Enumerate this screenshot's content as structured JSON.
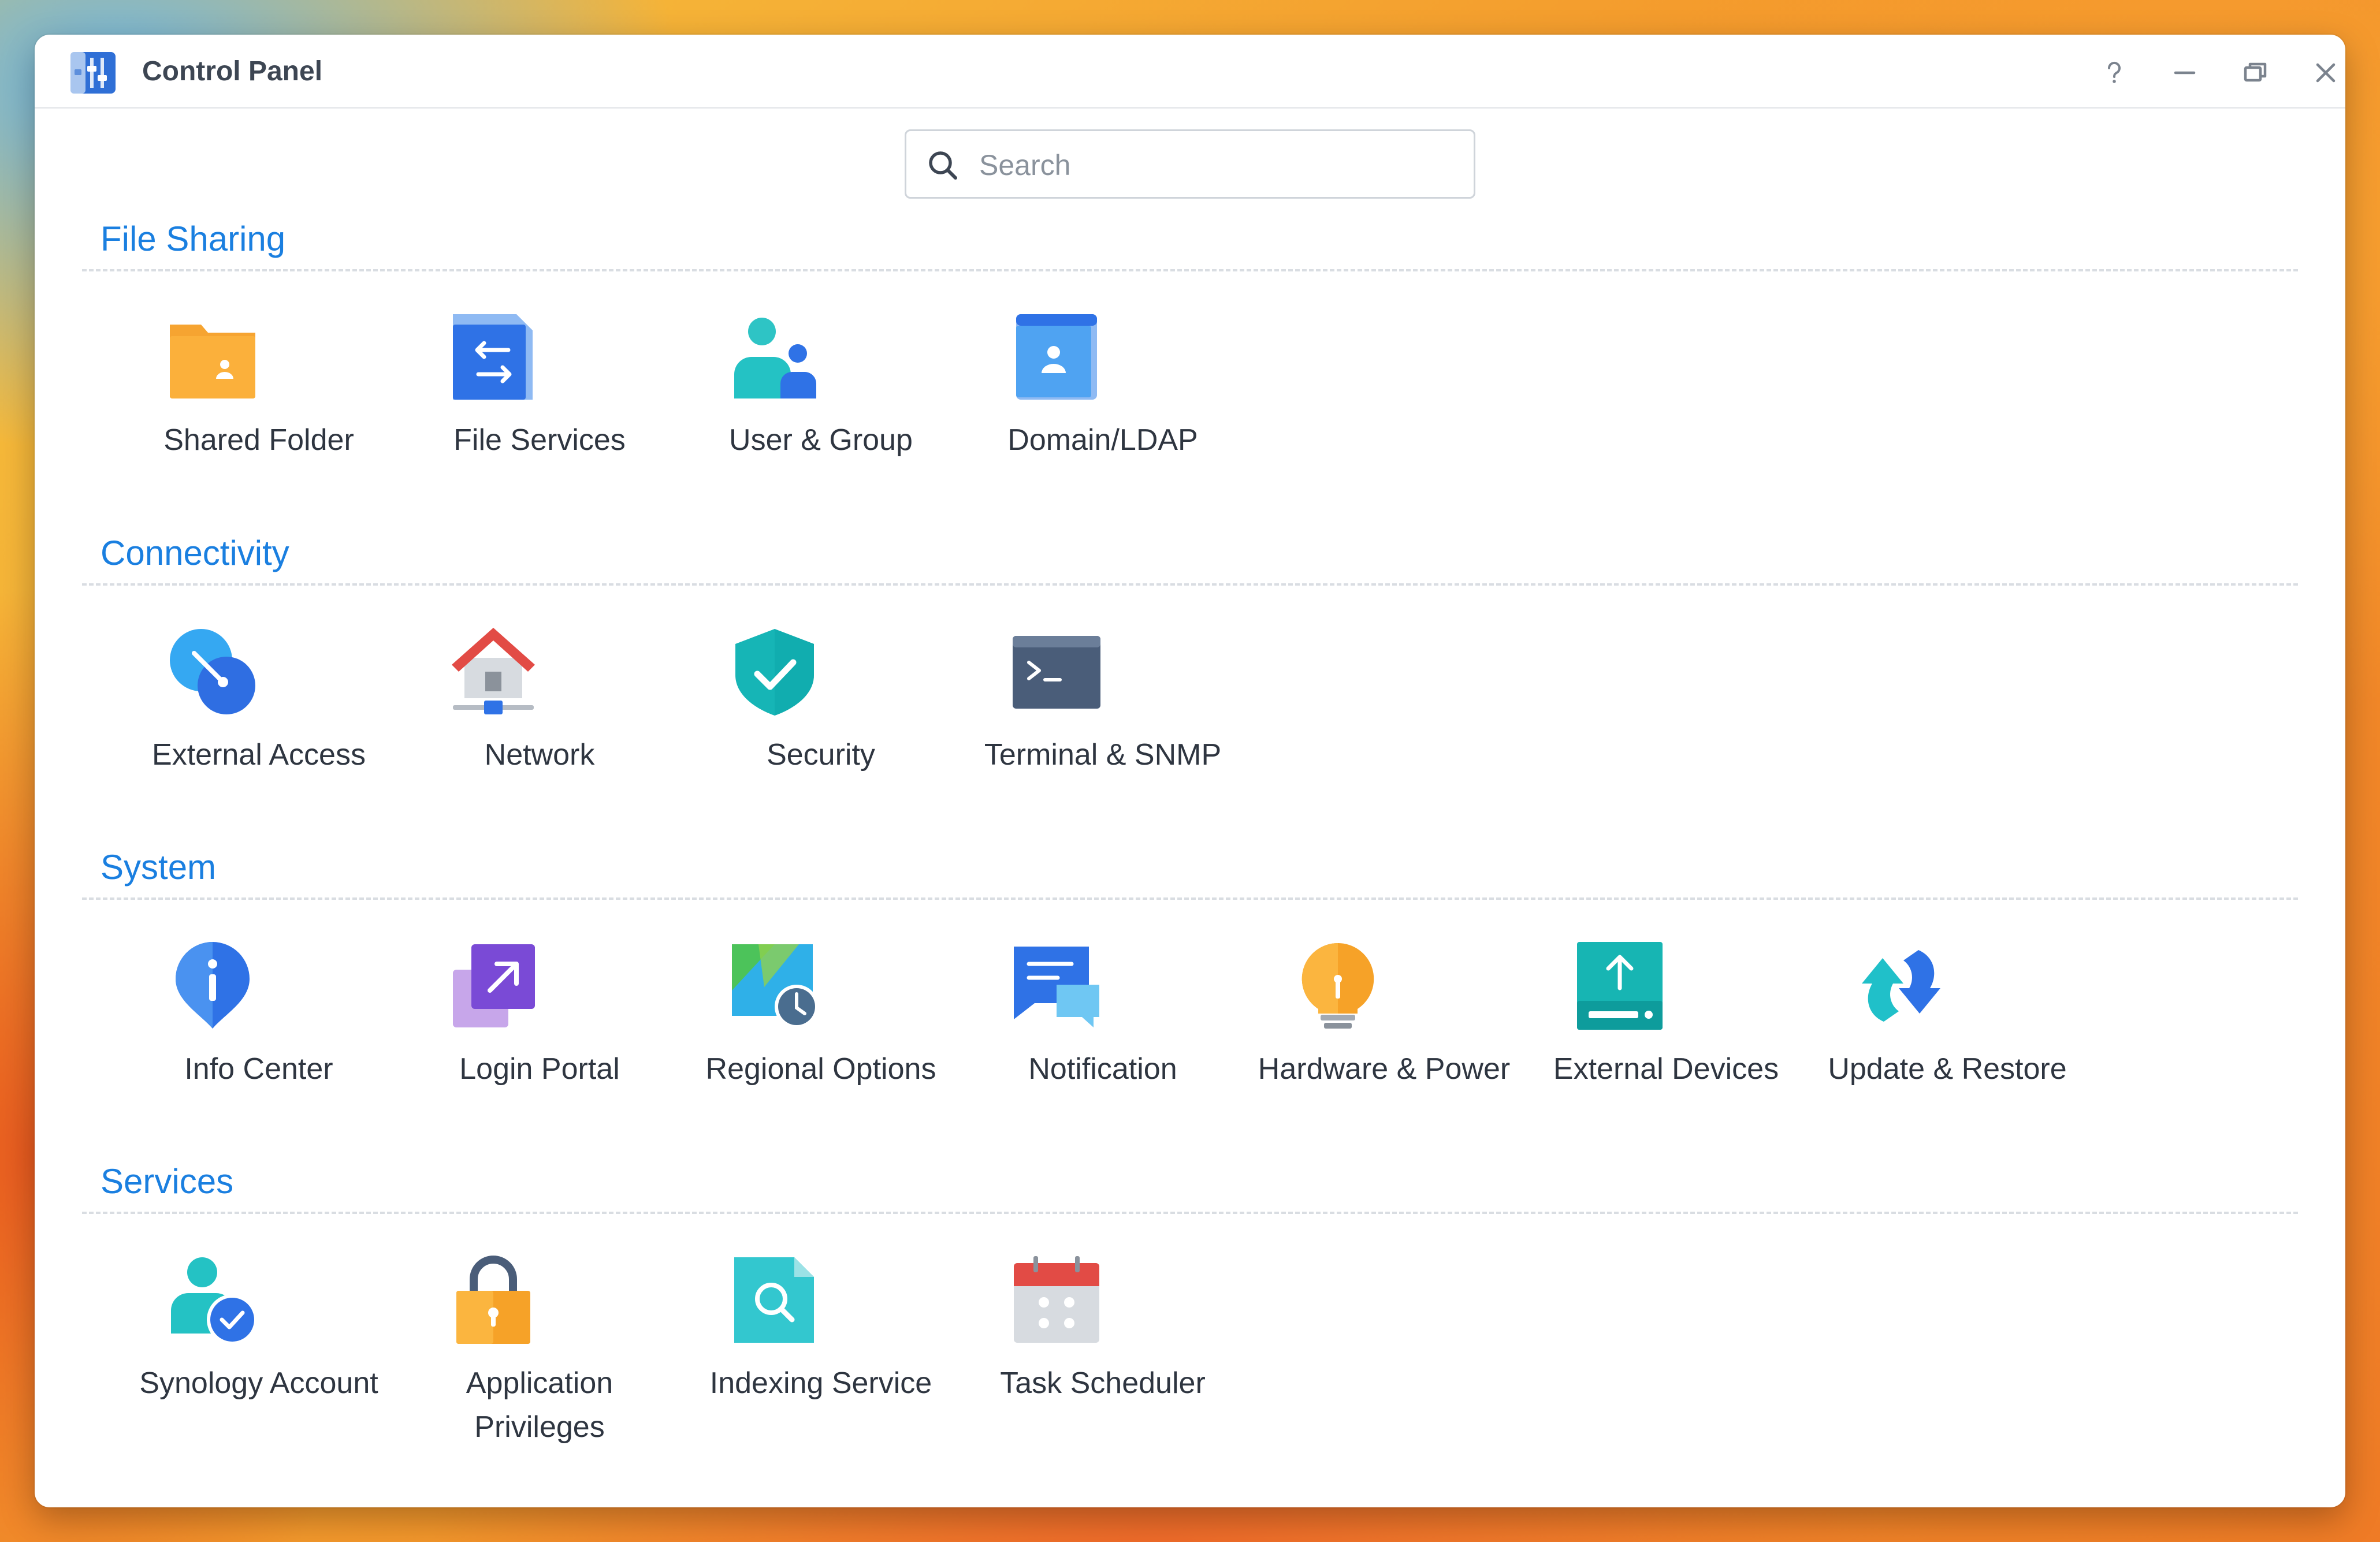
{
  "window": {
    "title": "Control Panel",
    "controls": {
      "help": "?",
      "minimize": "minimize",
      "restore": "restore",
      "close": "close"
    }
  },
  "search": {
    "placeholder": "Search",
    "value": ""
  },
  "sections": [
    {
      "title": "File Sharing",
      "items": [
        {
          "label": "Shared Folder",
          "icon": "shared-folder-icon"
        },
        {
          "label": "File Services",
          "icon": "file-services-icon"
        },
        {
          "label": "User & Group",
          "icon": "user-group-icon"
        },
        {
          "label": "Domain/LDAP",
          "icon": "domain-ldap-icon"
        }
      ]
    },
    {
      "title": "Connectivity",
      "items": [
        {
          "label": "External Access",
          "icon": "external-access-icon"
        },
        {
          "label": "Network",
          "icon": "network-icon"
        },
        {
          "label": "Security",
          "icon": "security-shield-icon"
        },
        {
          "label": "Terminal & SNMP",
          "icon": "terminal-icon"
        }
      ]
    },
    {
      "title": "System",
      "items": [
        {
          "label": "Info Center",
          "icon": "info-center-icon"
        },
        {
          "label": "Login Portal",
          "icon": "login-portal-icon"
        },
        {
          "label": "Regional Options",
          "icon": "regional-options-icon"
        },
        {
          "label": "Notification",
          "icon": "notification-icon"
        },
        {
          "label": "Hardware & Power",
          "icon": "hardware-power-icon"
        },
        {
          "label": "External Devices",
          "icon": "external-devices-icon"
        },
        {
          "label": "Update & Restore",
          "icon": "update-restore-icon"
        }
      ]
    },
    {
      "title": "Services",
      "items": [
        {
          "label": "Synology Account",
          "icon": "synology-account-icon"
        },
        {
          "label": "Application Privileges",
          "icon": "application-privileges-icon"
        },
        {
          "label": "Indexing Service",
          "icon": "indexing-service-icon"
        },
        {
          "label": "Task Scheduler",
          "icon": "task-scheduler-icon"
        }
      ]
    }
  ],
  "colors": {
    "section_title": "#1a7fe0",
    "label_text": "#2e3540",
    "title_text": "#3d4653"
  }
}
